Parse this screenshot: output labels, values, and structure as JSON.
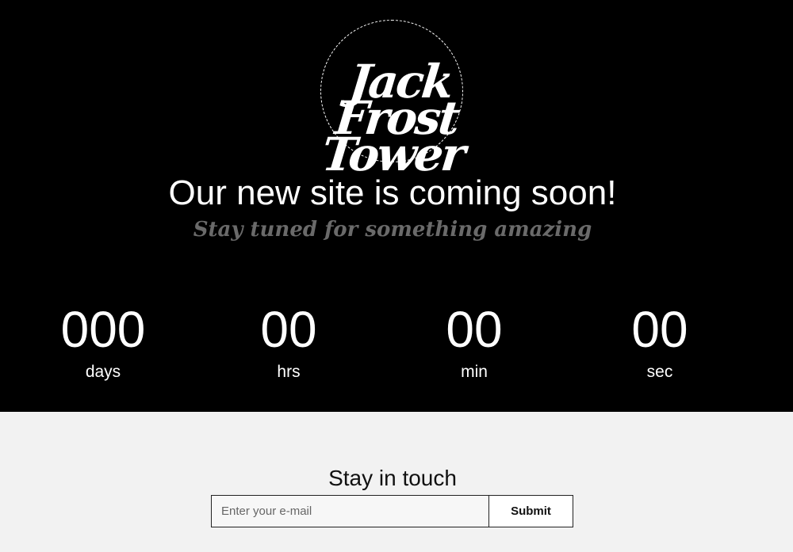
{
  "logo": {
    "lines": [
      "Jack",
      "Frost",
      "Tower"
    ]
  },
  "hero": {
    "headline": "Our new site is coming soon!",
    "subline": "Stay tuned for something amazing"
  },
  "countdown": [
    {
      "value": "000",
      "unit": "days"
    },
    {
      "value": "00",
      "unit": "hrs"
    },
    {
      "value": "00",
      "unit": "min"
    },
    {
      "value": "00",
      "unit": "sec"
    }
  ],
  "newsletter": {
    "title": "Stay in touch",
    "email_placeholder": "Enter your e-mail",
    "submit_label": "Submit"
  },
  "colors": {
    "hero_bg": "#000000",
    "footer_bg": "#f2f2f2",
    "subline": "#6a6a6a"
  }
}
